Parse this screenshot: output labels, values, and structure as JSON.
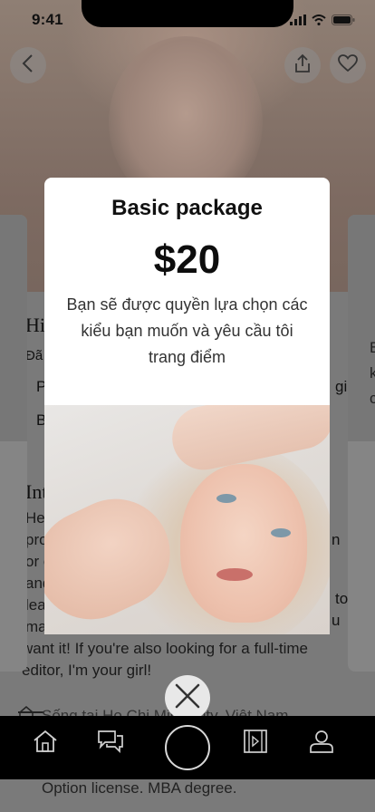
{
  "status_bar": {
    "time": "9:41"
  },
  "background": {
    "profile_initial": "Hi",
    "profile_sub": "Đã t",
    "profile_line3": "P",
    "profile_line3_right": "gi",
    "profile_line4": "B",
    "intro_heading": "Int",
    "intro_lines": [
      "Hey",
      "proj",
      "or e",
      "and",
      "lear",
      "ma",
      "want it!   If you're also looking for a full-time",
      "editor, I'm your girl!"
    ],
    "right_fragments": [
      "n",
      "to",
      "u"
    ],
    "right_card_letters": [
      "B",
      "k",
      "c"
    ],
    "location": "Sống tại Ho Chi Minh City, Việt Nam",
    "footer_text": "Option license. MBA degree."
  },
  "package_card": {
    "title": "Basic package",
    "price": "$20",
    "description": "Bạn sẽ được quyền lựa chọn các kiểu bạn muốn và yêu cầu tôi trang điểm"
  },
  "icons": {
    "back": "chevron-left-icon",
    "share": "share-icon",
    "favorite": "heart-icon",
    "close": "close-icon",
    "tabs": [
      "home-icon",
      "chat-icon",
      "record-icon",
      "film-icon",
      "user-icon"
    ]
  },
  "colors": {
    "tabbar": "#000000",
    "card": "#ffffff",
    "overlay": "#7a7a7a"
  }
}
